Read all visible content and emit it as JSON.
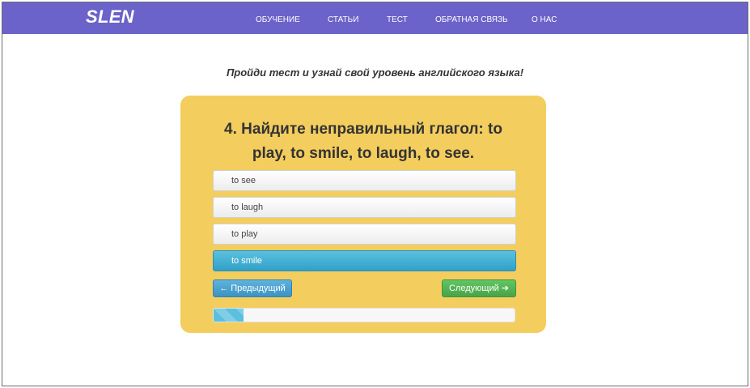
{
  "brand": "SLEN",
  "nav": {
    "items": [
      "ОБУЧЕНИЕ",
      "СТАТЬИ",
      "ТЕСТ",
      "ОБРАТНАЯ СВЯЗЬ",
      "О НАС"
    ]
  },
  "subtitle": "Пройди тест и узнай свой уровень английского языка!",
  "quiz": {
    "question_line1": "4. Найдите неправильный глагол: to",
    "question_line2": "play, to smile, to laugh, to see.",
    "options": [
      {
        "label": "to see",
        "selected": false
      },
      {
        "label": "to laugh",
        "selected": false
      },
      {
        "label": "to play",
        "selected": false
      },
      {
        "label": "to smile",
        "selected": true
      }
    ],
    "prev_label": "← Предыдущий",
    "next_label": "Следующий ➔",
    "progress_fraction": 0.1
  },
  "colors": {
    "navbar": "#6b63c9",
    "card": "#f3ce5e",
    "selected_option": "#31a1c8",
    "prev_button": "#3b93c4",
    "next_button": "#47a447",
    "progress": "#5bc0de"
  }
}
